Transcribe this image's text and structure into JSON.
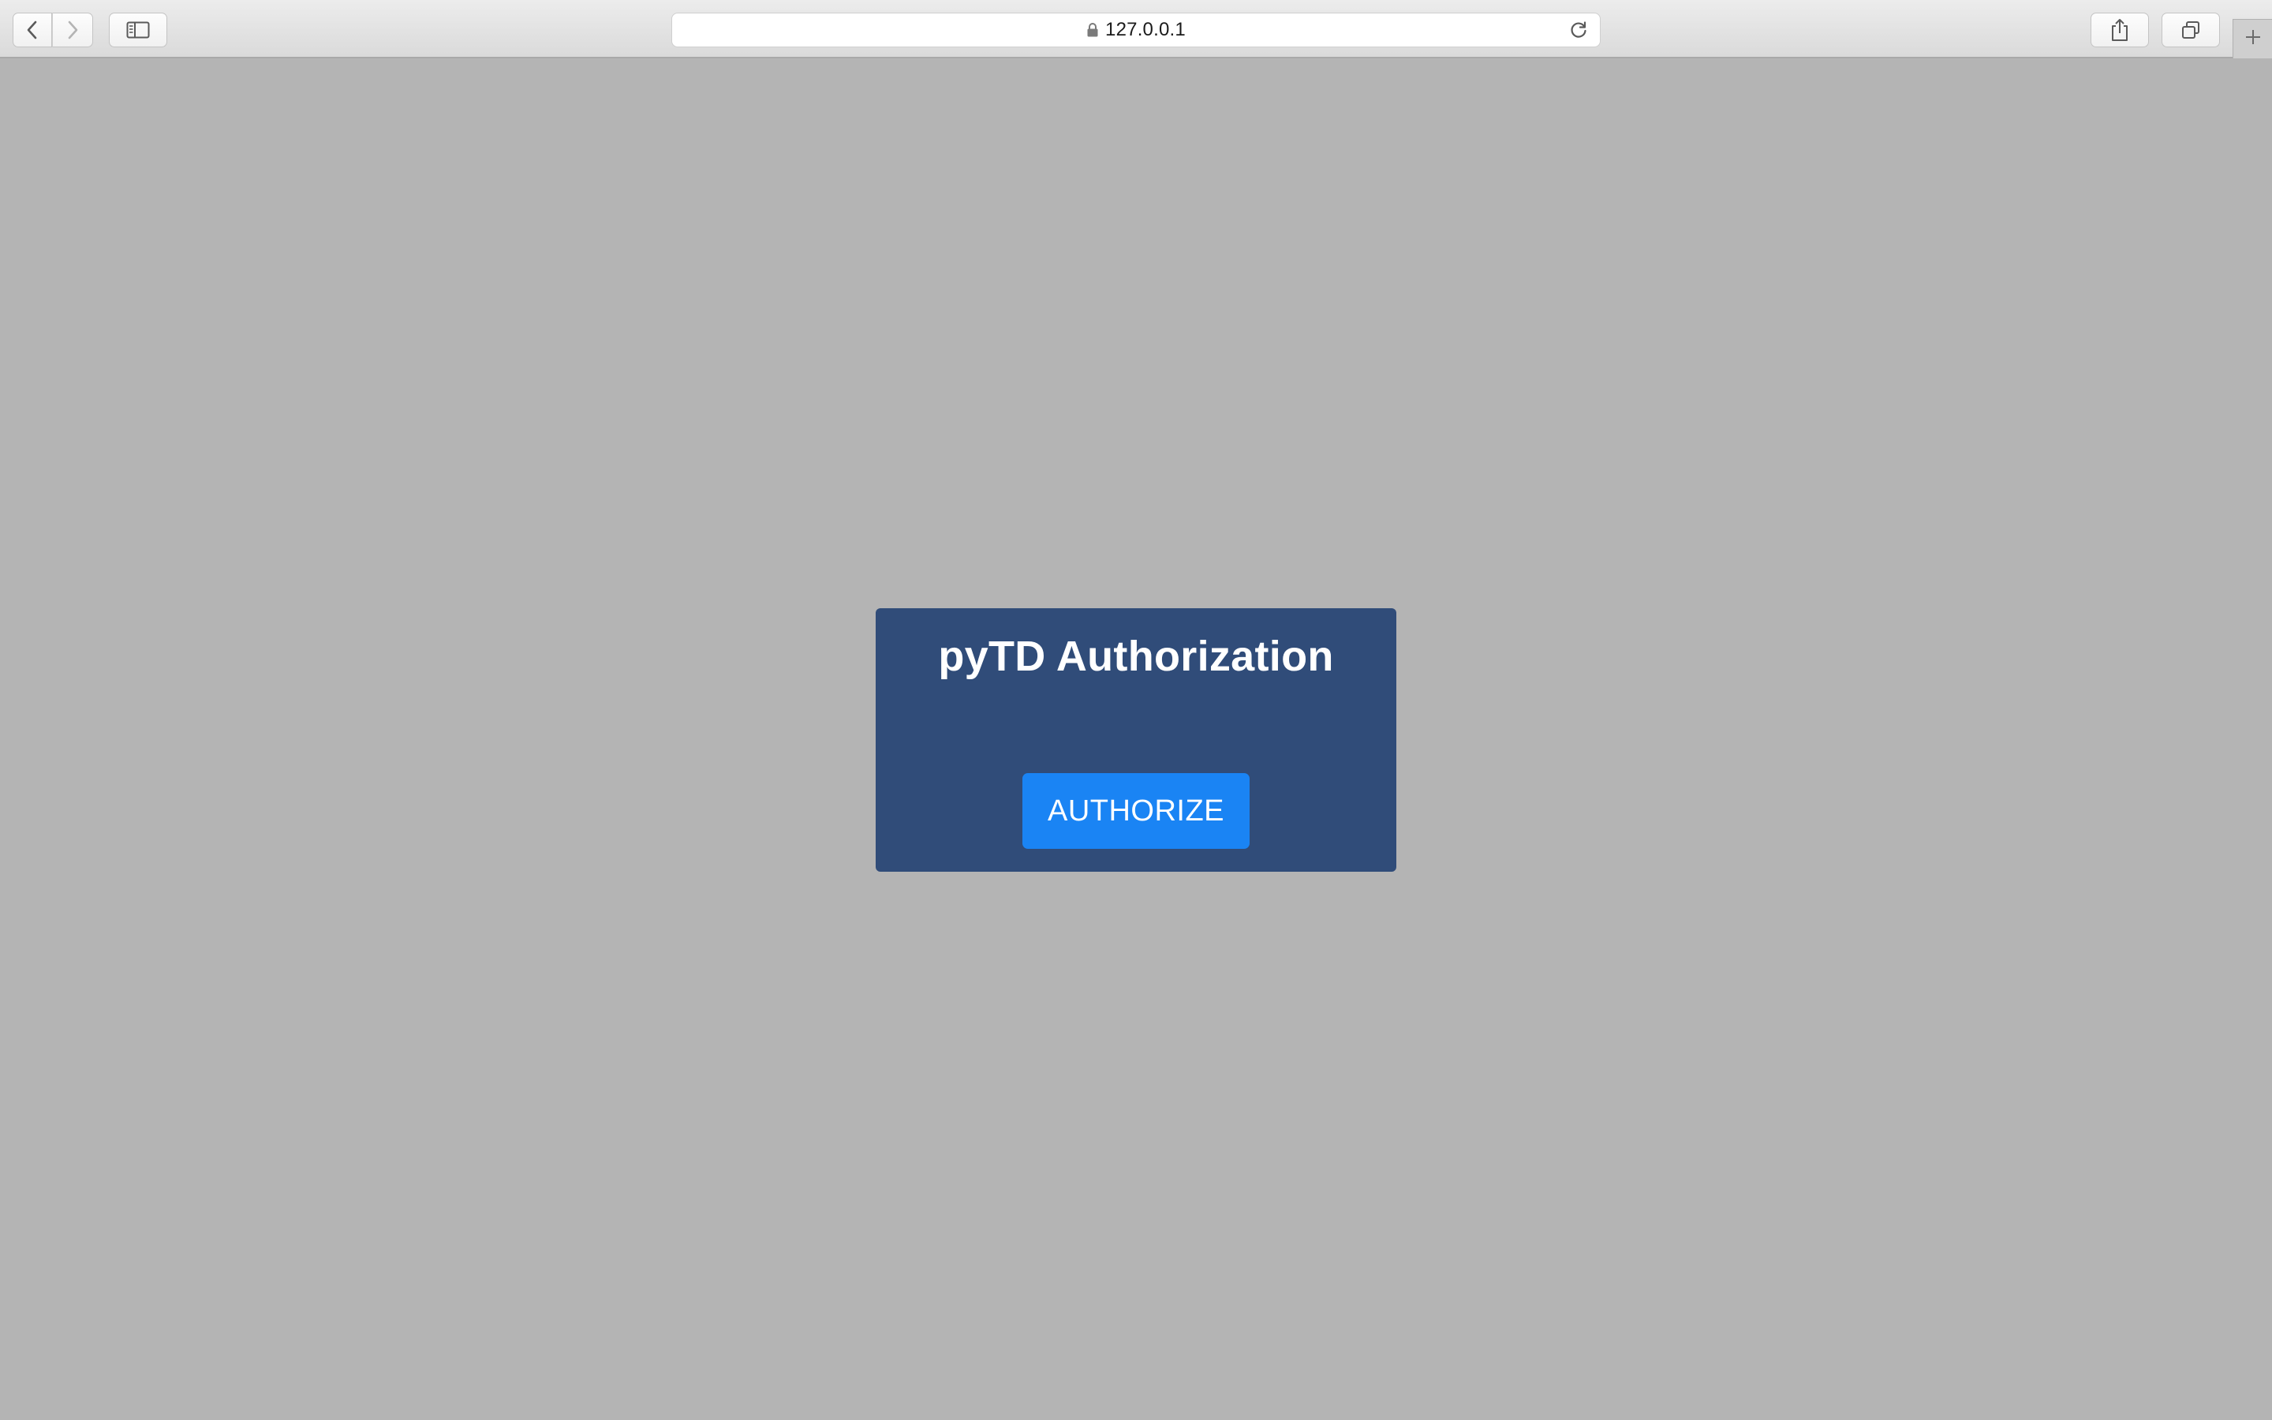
{
  "browser": {
    "url": "127.0.0.1",
    "icons": {
      "back": "chevron-left-icon",
      "forward": "chevron-right-icon",
      "sidebar": "sidebar-icon",
      "lock": "lock-icon",
      "reload": "reload-icon",
      "share": "share-icon",
      "tabs": "tabs-icon",
      "new_tab": "plus-icon"
    }
  },
  "auth": {
    "title": "pyTD Authorization",
    "button_label": "AUTHORIZE"
  },
  "colors": {
    "page_background": "#b4b4b4",
    "card_background": "#304c79",
    "button_background": "#1a84f4",
    "text_on_dark": "#ffffff"
  }
}
